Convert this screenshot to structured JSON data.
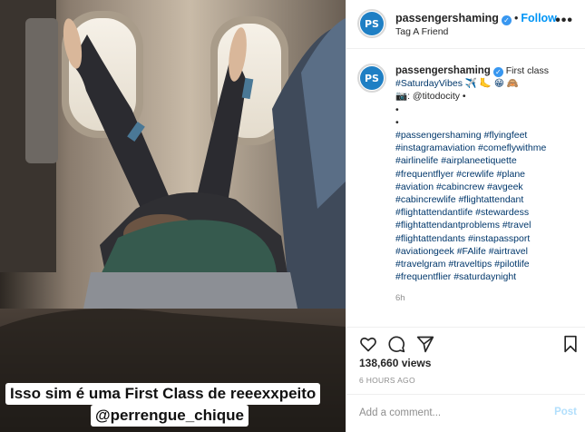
{
  "header": {
    "username": "passengershaming",
    "separator": "•",
    "follow_label": "Follow",
    "subtitle": "Tag A Friend",
    "more_label": "•••",
    "avatar_text": "PS"
  },
  "caption": {
    "username": "passengershaming",
    "line1": "First class",
    "line2": "#SaturdayVibes ✈️ 🦶 😁 🙈",
    "credit": "📷: @titodocity •",
    "dots": [
      "•",
      "•"
    ],
    "hashtags": [
      "#passengershaming #flyingfeet",
      "#instagramaviation #comeflywithme",
      "#airlinelife #airplaneetiquette",
      "#frequentflyer #crewlife #plane",
      "#aviation #cabincrew #avgeek",
      "#cabincrewlife #flightattendant",
      "#flightattendantlife #stewardess",
      "#flightattendantproblems #travel",
      "#flightattendants #instapassport",
      "#aviationgeek #FAlife #airtravel",
      "#travelgram #traveltips #pilotlife",
      "#frequentflier #saturdaynight"
    ],
    "time": "6h"
  },
  "media": {
    "overlay_line1": "Isso sim é uma First Class de reeexxpeito",
    "overlay_line2": "@perrengue_chique"
  },
  "stats": {
    "views": "138,660 views",
    "posted": "6 HOURS AGO"
  },
  "comment_box": {
    "placeholder": "Add a comment...",
    "post_label": "Post"
  },
  "colors": {
    "link_blue": "#0095f6",
    "hashtag": "#00376b",
    "muted": "#8e8e8e",
    "post_disabled": "#b2dffc"
  },
  "icons": [
    "heart-icon",
    "comment-icon",
    "share-icon",
    "bookmark-icon",
    "verified-badge-icon",
    "more-icon"
  ]
}
